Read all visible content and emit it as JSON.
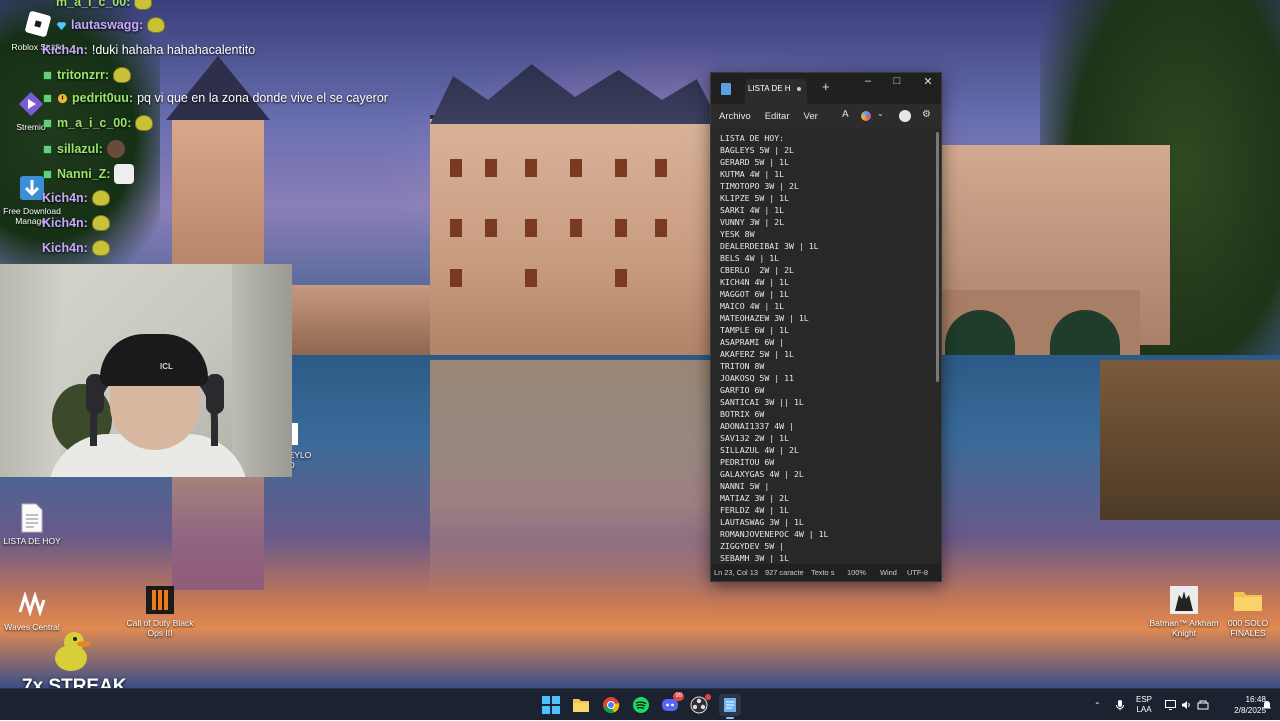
{
  "desktop_icons": [
    {
      "label": "Roblox Studio"
    },
    {
      "label": "Stremio"
    },
    {
      "label": "Free Download Manager"
    },
    {
      "label": "LISTA DE HOY"
    },
    {
      "label": "Waves Central"
    },
    {
      "label": "Call of Duty Black Ops III"
    },
    {
      "label": "Batman™ Arkham Knight"
    },
    {
      "label": "000 SOLO FINALES"
    },
    {
      "label": "GEYLO DO"
    }
  ],
  "chat": {
    "messages": [
      {
        "user": "m_a_i_c_00:",
        "text": "",
        "color": "#9be36b"
      },
      {
        "user": "lautaswagg:",
        "text": "",
        "color": "#c9a8ff"
      },
      {
        "user": "Kich4n:",
        "text": "!duki hahaha hahahacalentito",
        "color": "#c9a8ff"
      },
      {
        "user": "tritonzrr:",
        "text": "",
        "color": "#9be36b"
      },
      {
        "user": "pedrit0uu:",
        "text": "pq vi que en la zona donde vive el se cayeror",
        "color": "#9be36b"
      },
      {
        "user": "m_a_i_c_00:",
        "text": "",
        "color": "#9be36b"
      },
      {
        "user": "sillazul:",
        "text": "",
        "color": "#9be36b"
      },
      {
        "user": "Nanni_Z:",
        "text": "",
        "color": "#9be36b"
      },
      {
        "user": "Kich4n:",
        "text": "",
        "color": "#c9a8ff"
      },
      {
        "user": "Kich4n:",
        "text": "",
        "color": "#c9a8ff"
      },
      {
        "user": "Kich4n:",
        "text": "",
        "color": "#c9a8ff"
      }
    ]
  },
  "webcam": {
    "beanie_text": "ICL"
  },
  "streak": {
    "text": "7x STREAK"
  },
  "notepad": {
    "tab_title": "LISTA DE H",
    "menu": [
      "Archivo",
      "Editar",
      "Ver"
    ],
    "content": "LISTA DE HOY:\nBAGLEYS 5W | 2L\nGERARD 5W | 1L\nKUTMA 4W | 1L\nTIMOTOPO 3W | 2L\nKLIPZE 5W | 1L\nSARKI 4W | 1L\nVUNNY 3W | 2L\nYESK 8W\nDEALERDEIBAI 3W | 1L\nBELS 4W | 1L\nCBERLO  2W | 2L\nKICH4N 4W | 1L\nMAGGOT 6W | 1L\nMAICO 4W | 1L\nMATEOHAZEW 3W | 1L\nTAMPLE 6W | 1L\nASAPRAMI 6W |\nAKAFERZ 5W | 1L\nTRITON 8W\nJOAKOSQ 5W | 11\nGARFIO 6W\nSANTICAI 3W || 1L\nBOTRIX 6W\nADONAI1337 4W |\nSAV132 2W | 1L\nSILLAZUL 4W | 2L\nPEDRITOU 6W\nGALAXYGAS 4W | 2L\nNANNI 5W |\nMATIAZ 3W | 2L\nFERLDZ 4W | 1L\nLAUTASWAG 3W | 1L\nROMANJOVENEPOC 4W | 1L\nZIGGYDEV 5W |\nSEBAMH 3W | 1L",
    "status": {
      "position": "Ln 23, Col 13",
      "chars": "927 caracte",
      "format": "Texto s",
      "zoom": "100%",
      "line_ending": "Wind",
      "encoding": "UTF-8"
    }
  },
  "taskbar": {
    "apps": [
      "start",
      "file-explorer",
      "chrome",
      "spotify",
      "discord",
      "obs",
      "notepad"
    ],
    "discord_badge": "99",
    "language": {
      "lang": "ESP",
      "region": "LAA"
    },
    "time": "16:48",
    "date": "2/8/2025"
  }
}
